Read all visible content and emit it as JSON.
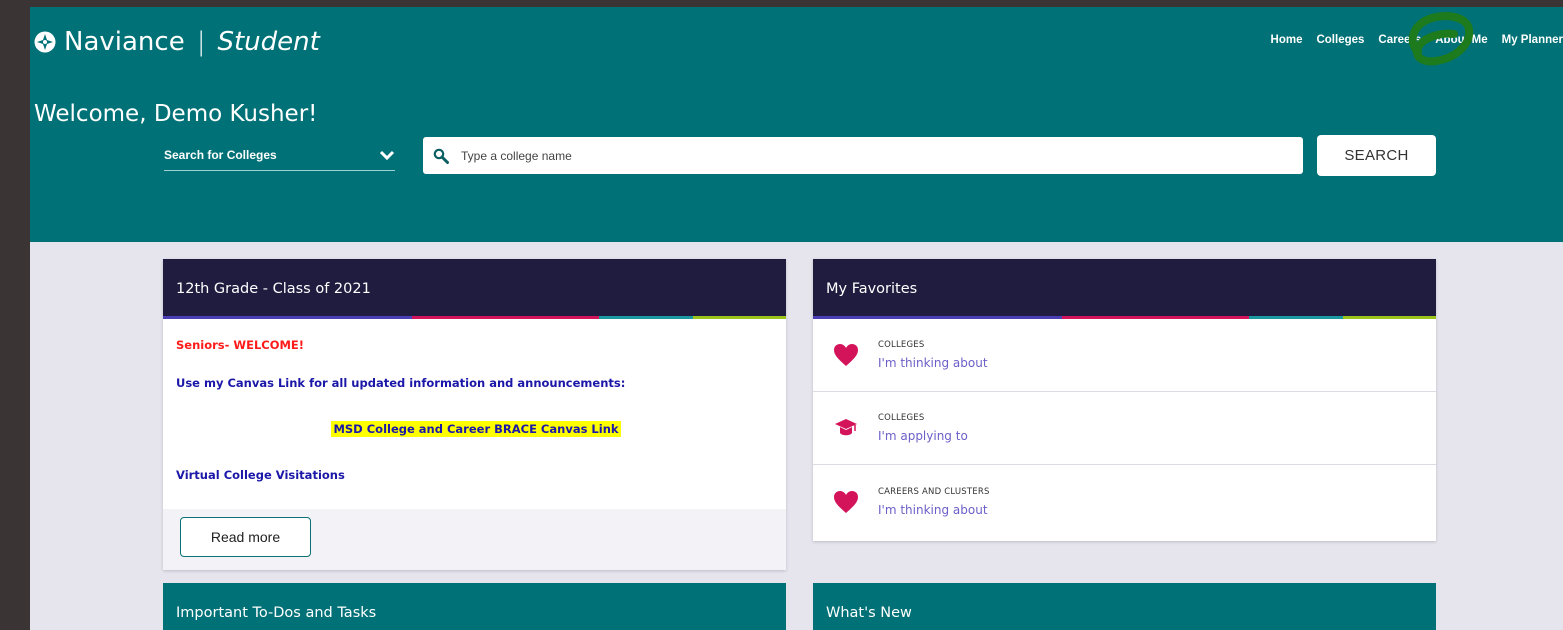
{
  "brand": {
    "name": "Naviance",
    "separator": "|",
    "product": "Student"
  },
  "nav": {
    "home": "Home",
    "colleges": "Colleges",
    "careers": "Careers",
    "about_me": "About Me",
    "my_planner": "My Planner"
  },
  "welcome": "Welcome, Demo Kusher!",
  "search": {
    "mode": "Search for Colleges",
    "placeholder": "Type a college name",
    "button": "SEARCH"
  },
  "announcement": {
    "title": "12th Grade - Class of 2021",
    "line1": "Seniors- WELCOME!",
    "line2": "Use my Canvas Link for all updated information and announcements:",
    "link": "MSD College and Career BRACE Canvas Link",
    "line4": "Virtual College Visitations",
    "read_more": "Read more"
  },
  "favorites": {
    "title": "My Favorites",
    "items": [
      {
        "category": "COLLEGES",
        "link": "I'm thinking about",
        "icon": "heart-icon"
      },
      {
        "category": "COLLEGES",
        "link": "I'm applying to",
        "icon": "graduation-cap-icon"
      },
      {
        "category": "CAREERS AND CLUSTERS",
        "link": "I'm thinking about",
        "icon": "heart-icon"
      }
    ]
  },
  "todos": {
    "title": "Important To-Dos and Tasks"
  },
  "whats_new": {
    "title": "What's New"
  },
  "colors": {
    "teal": "#007176",
    "navy": "#1f1c40",
    "pink": "#d4145a",
    "link_purple": "#6b5fc8",
    "annotation_green": "#1d7a1d"
  }
}
